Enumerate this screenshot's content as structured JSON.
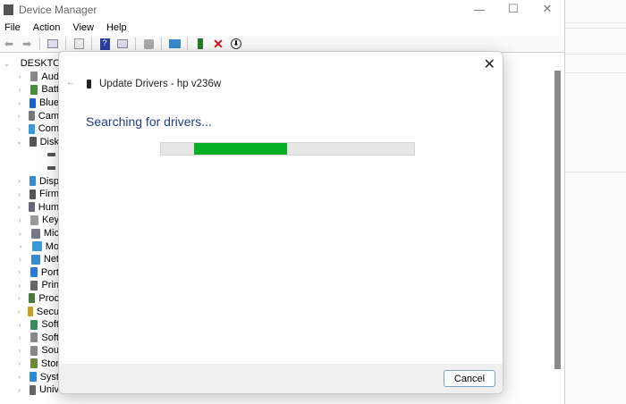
{
  "window": {
    "title": "Device Manager",
    "minimize": "—",
    "maximize": "☐",
    "close": "✕"
  },
  "menu": [
    "File",
    "Action",
    "View",
    "Help"
  ],
  "toolbar_icons": [
    "back-arrow",
    "forward-arrow",
    "properties",
    "show-hidden",
    "help",
    "action-view",
    "update-driver",
    "monitor",
    "enable-device",
    "uninstall-red-x",
    "download"
  ],
  "tree": [
    {
      "label": "DESKTO",
      "expanded": true,
      "color": "#666"
    },
    {
      "label": "Aud",
      "color": "#888"
    },
    {
      "label": "Batt",
      "color": "#4a8a3a"
    },
    {
      "label": "Blue",
      "color": "#1a5fd0"
    },
    {
      "label": "Cam",
      "color": "#777"
    },
    {
      "label": "Com",
      "color": "#3a9ad9"
    },
    {
      "label": "Disk",
      "expanded": true,
      "color": "#555"
    },
    {
      "label": "",
      "child": true,
      "color": "#555"
    },
    {
      "label": "",
      "child": true,
      "color": "#555"
    },
    {
      "label": "Disp",
      "color": "#3a8ad0"
    },
    {
      "label": "Firm",
      "color": "#555"
    },
    {
      "label": "Hum",
      "color": "#667"
    },
    {
      "label": "Key",
      "color": "#999"
    },
    {
      "label": "Mic",
      "color": "#778"
    },
    {
      "label": "Mo",
      "color": "#3a9ad9"
    },
    {
      "label": "Net",
      "color": "#3a8ad0"
    },
    {
      "label": "Port",
      "color": "#2a7ad0"
    },
    {
      "label": "Prin",
      "color": "#666"
    },
    {
      "label": "Proc",
      "color": "#4a7a3a"
    },
    {
      "label": "Secu",
      "color": "#c9a020"
    },
    {
      "label": "Soft",
      "color": "#3a8a5a"
    },
    {
      "label": "Soft",
      "color": "#888"
    },
    {
      "label": "Sou",
      "color": "#888"
    },
    {
      "label": "Stor",
      "color": "#6a8a3a"
    },
    {
      "label": "Syst",
      "color": "#2a8ad0"
    },
    {
      "label": "Univ",
      "color": "#666"
    }
  ],
  "dialog": {
    "back": "←",
    "title": "Update Drivers - hp v236w",
    "status": "Searching for drivers...",
    "close": "✕",
    "cancel": "Cancel",
    "progress": "indeterminate",
    "accent": "#06b025"
  }
}
